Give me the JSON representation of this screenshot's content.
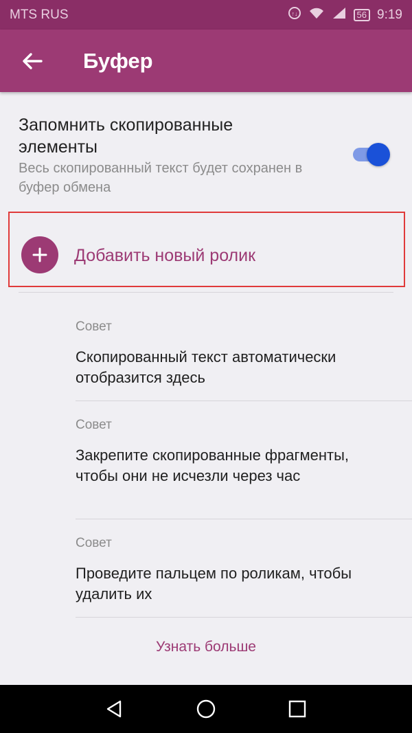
{
  "status_bar": {
    "carrier": "MTS RUS",
    "battery_level": "56",
    "time": "9:19",
    "icons": [
      "data-saver-icon",
      "wifi-icon",
      "signal-icon",
      "battery-icon"
    ]
  },
  "app_bar": {
    "title": "Буфер",
    "back_icon": "arrow-back-icon"
  },
  "setting": {
    "title": "Запомнить скопированные элементы",
    "description": "Весь скопированный текст будет сохранен в буфер обмена",
    "toggle_on": true
  },
  "add_clip": {
    "label": "Добавить новый ролик",
    "icon": "plus-icon"
  },
  "tips": [
    {
      "label": "Совет",
      "text": "Скопированный текст автоматически отобразится здесь"
    },
    {
      "label": "Совет",
      "text": "Закрепите скопированные фрагменты, чтобы они не исчезли через час"
    },
    {
      "label": "Совет",
      "text": "Проведите пальцем по роликам, чтобы удалить их"
    }
  ],
  "learn_more": "Узнать больше",
  "nav_bar": [
    "back-triangle-icon",
    "home-circle-icon",
    "recents-square-icon"
  ],
  "colors": {
    "primary": "#9c3a74",
    "status_bar": "#8a2e66",
    "toggle_thumb": "#1a51d8",
    "highlight_border": "#e03a3a"
  }
}
